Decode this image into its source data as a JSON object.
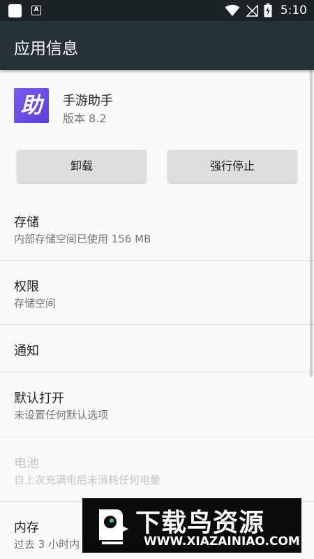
{
  "status_bar": {
    "notif_small": "A",
    "time": "5:10"
  },
  "toolbar": {
    "title": "应用信息"
  },
  "app": {
    "icon_glyph": "助",
    "name": "手游助手",
    "version": "版本 8.2",
    "brand_color": "#6a4cf0"
  },
  "buttons": {
    "uninstall": "卸载",
    "force_stop": "强行停止"
  },
  "rows": [
    {
      "title": "存储",
      "subtitle": "内部存储空间已使用 156 MB",
      "enabled": true
    },
    {
      "title": "权限",
      "subtitle": "存储空间",
      "enabled": true
    },
    {
      "title": "通知",
      "subtitle": "",
      "enabled": true
    },
    {
      "title": "默认打开",
      "subtitle": "未设置任何默认选项",
      "enabled": true
    },
    {
      "title": "电池",
      "subtitle": "自上次充满电后未消耗任何电量",
      "enabled": false
    },
    {
      "title": "内存",
      "subtitle": "过去 3 小时内",
      "enabled": true
    }
  ],
  "watermark": {
    "title": "下载鸟资源",
    "url": "WWW.XIAZAINIAO.COM"
  }
}
